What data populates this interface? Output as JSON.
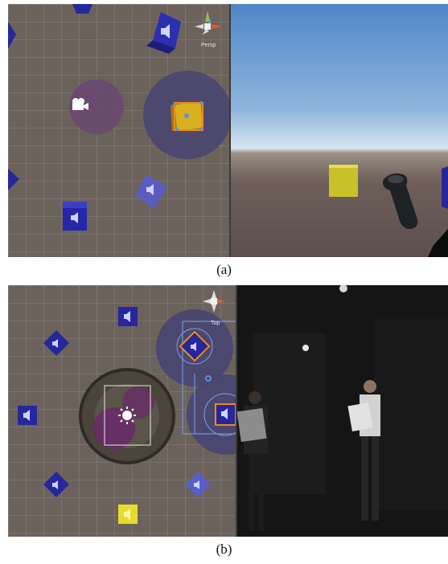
{
  "captions": {
    "a": "(a)",
    "b": "(b)"
  },
  "views": {
    "top_scene_view": {
      "gizmo_label": "Persp"
    },
    "bottom_scene_view": {
      "gizmo_label": "Top"
    }
  },
  "icons": {
    "speaker": "speaker-icon",
    "camera": "camera-icon",
    "sun": "sun-icon",
    "controller": "vr-controller-icon"
  },
  "colors": {
    "scene_grid": "#6b625c",
    "speaker_cube": "#25279a",
    "yellow_cube": "#d9cf2a",
    "listener_zone": "#6a4a86",
    "audio_range": "#4a4670",
    "sky_top": "#4f86c8",
    "ground": "#6e5f5b",
    "stage_dark": "#141414"
  }
}
